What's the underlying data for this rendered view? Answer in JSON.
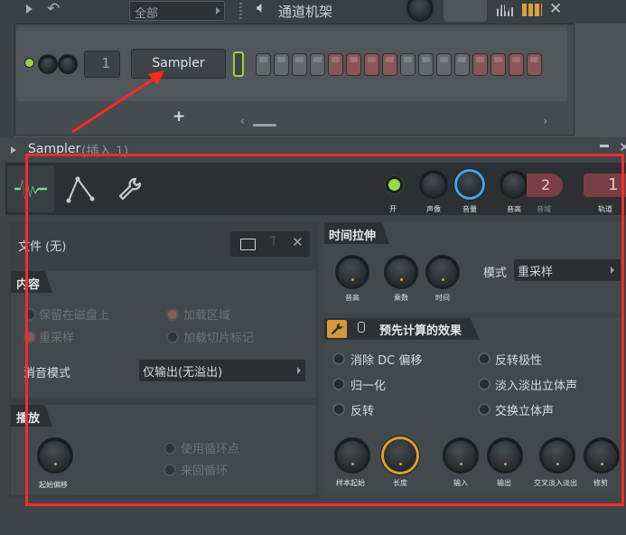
{
  "channel_rack": {
    "filter_label": "全部",
    "title": "通道机架",
    "channel_number": "1",
    "channel_name": "Sampler",
    "add_button": "+"
  },
  "plugin_window": {
    "title": "Sampler",
    "title_suffix": "(插入 1)",
    "knobs_top": {
      "on_label": "开",
      "pan_label": "声像",
      "volume_label": "音量",
      "pitch_label": "音高",
      "range_label": "音域",
      "range_value": "2",
      "track_label": "轨道",
      "track_value": "1"
    },
    "file": {
      "label": "文件 (无)"
    },
    "content": {
      "header": "内容",
      "keep_on_disk": "保留在磁盘上",
      "resample": "重采样",
      "load_regions": "加载区域",
      "load_slice_markers": "加载切片标记",
      "declick_label": "消音模式",
      "declick_value": "仅输出(无溢出)"
    },
    "playback": {
      "header": "播放",
      "start_offset": "起始偏移",
      "use_loop_points": "使用循环点",
      "ping_pong_loop": "来回循环"
    },
    "time_stretch": {
      "header": "时间拉伸",
      "pitch": "音高",
      "multiply": "乘数",
      "time": "时间",
      "mode_label": "模式",
      "mode_value": "重采样"
    },
    "precomputed": {
      "header": "预先计算的效果",
      "remove_dc": "消除 DC 偏移",
      "reverse_polarity": "反转极性",
      "normalize": "归一化",
      "fade_stereo": "淡入淡出立体声",
      "reverse": "反转",
      "swap_stereo": "交换立体声",
      "sample_start": "样本起始",
      "length": "长度",
      "in": "输入",
      "out": "输出",
      "crossfade": "交叉淡入淡出",
      "trim": "修剪"
    }
  }
}
